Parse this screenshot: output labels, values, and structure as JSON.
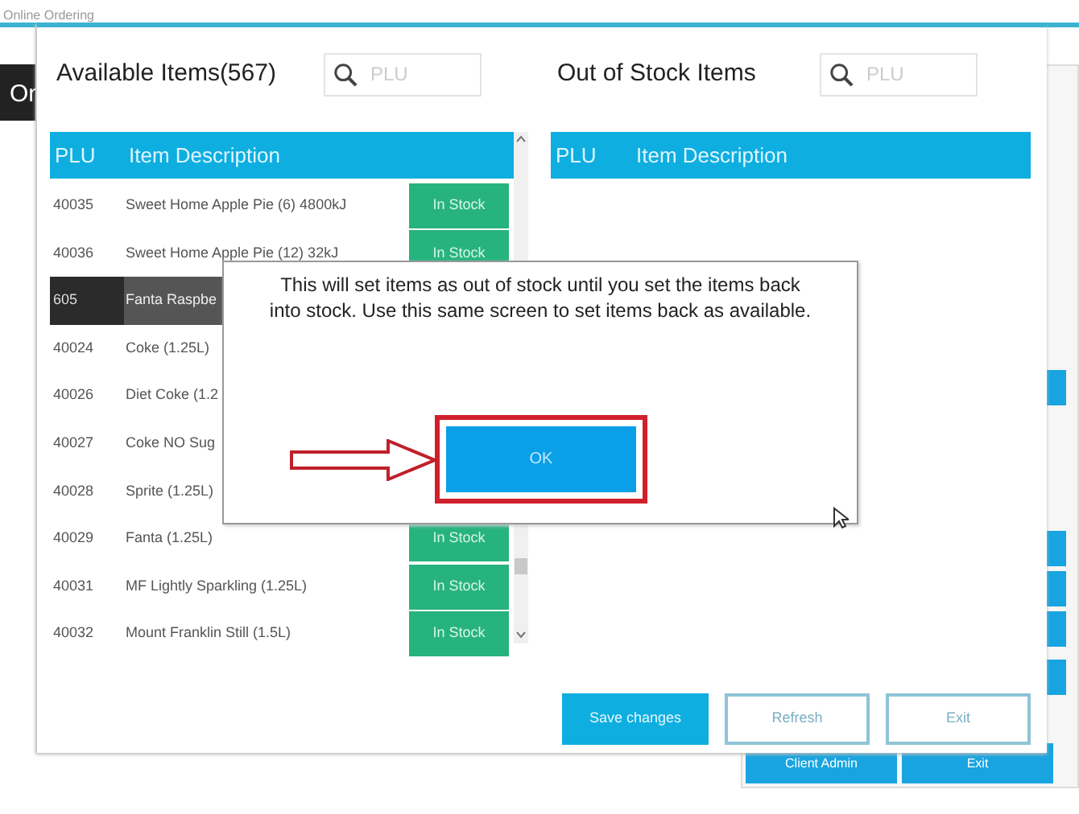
{
  "app": {
    "title": "Online Ordering",
    "tab": "On",
    "buttons": [
      "Client Admin",
      "Exit"
    ]
  },
  "stock_dialog": {
    "available": {
      "title": "Available Items(567)",
      "search": {
        "placeholder": "PLU"
      },
      "columns": [
        "PLU",
        "Item Description"
      ],
      "rows": [
        {
          "plu": "40035",
          "description": "Sweet Home Apple Pie (6) 4800kJ",
          "status": "In Stock",
          "selected": false
        },
        {
          "plu": "40036",
          "description": "Sweet Home Apple Pie (12) 32kJ",
          "status": "In Stock",
          "selected": false
        },
        {
          "plu": "605",
          "description": "Fanta Raspbe",
          "selected": true
        },
        {
          "plu": "40024",
          "description": "Coke (1.25L)",
          "selected": false
        },
        {
          "plu": "40026",
          "description": "Diet Coke (1.2",
          "selected": false
        },
        {
          "plu": "40027",
          "description": "Coke NO Sug",
          "selected": false
        },
        {
          "plu": "40028",
          "description": "Sprite (1.25L)",
          "selected": false
        },
        {
          "plu": "40029",
          "description": "Fanta (1.25L)",
          "status": "In Stock",
          "selected": false
        },
        {
          "plu": "40031",
          "description": "MF Lightly Sparkling (1.25L)",
          "status": "In Stock",
          "selected": false
        },
        {
          "plu": "40032",
          "description": "Mount Franklin Still (1.5L)",
          "status": "In Stock",
          "selected": false
        }
      ]
    },
    "out_of_stock": {
      "title": "Out of Stock Items",
      "search": {
        "placeholder": "PLU"
      },
      "columns": [
        "PLU",
        "Item Description"
      ]
    },
    "buttons": [
      {
        "label": "Save changes",
        "kind": "primary"
      },
      {
        "label": "Refresh",
        "kind": "outline"
      },
      {
        "label": "Exit",
        "kind": "outline"
      }
    ]
  },
  "message": {
    "text": "This will set items as out of stock until you set the items back into stock. Use this same screen to set items back as available.",
    "button": "OK"
  }
}
